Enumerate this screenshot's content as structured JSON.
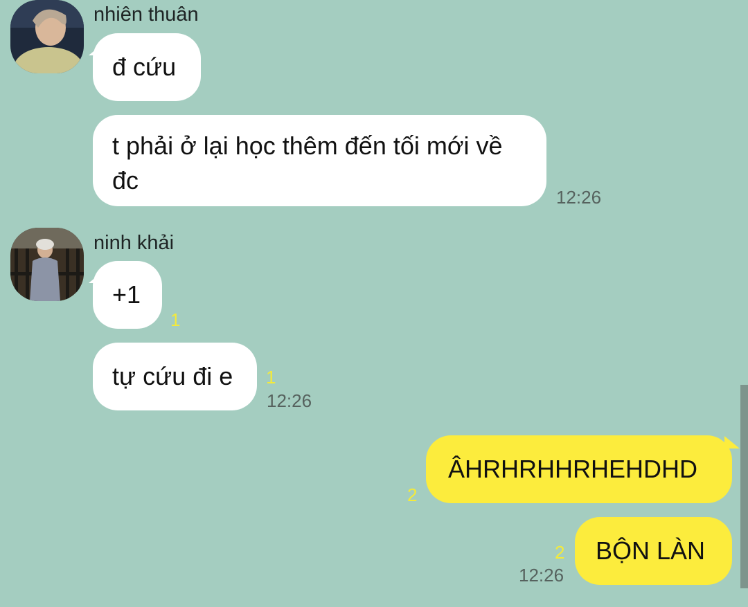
{
  "messages_incoming_1": {
    "sender": "nhiên thuân",
    "bubble_1": "đ cứu",
    "bubble_2_line_1": "t phải ở lại học thêm đến tối mới về",
    "bubble_2_line_2": "đc",
    "time": "12:26"
  },
  "messages_incoming_2": {
    "sender": "ninh khải",
    "bubble_1": "+1",
    "bubble_1_unread": "1",
    "bubble_2": "tự cứu đi e",
    "bubble_2_unread": "1",
    "time": "12:26"
  },
  "messages_outgoing": {
    "bubble_1": "ÂHRHRHHRHEHDHD",
    "bubble_1_unread": "2",
    "bubble_2": "BỘN LÀN",
    "bubble_2_unread": "2",
    "time": "12:26"
  },
  "colors": {
    "background": "#a4cdc0",
    "incoming_bubble": "#ffffff",
    "outgoing_bubble": "#fcec3d",
    "unread_count": "#f4ea3a",
    "timestamp": "#56625e"
  }
}
